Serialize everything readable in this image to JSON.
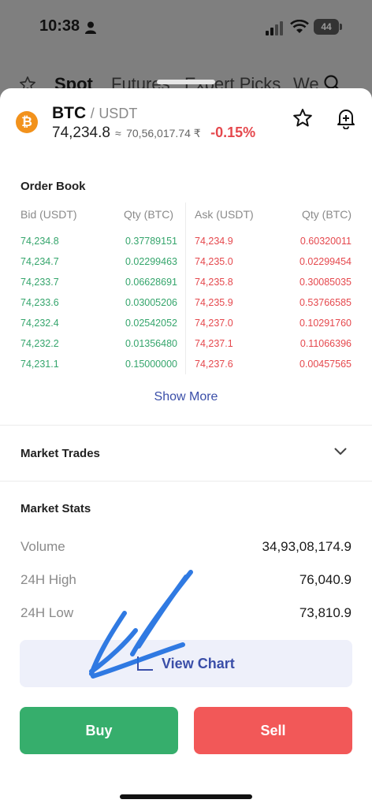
{
  "status_bar": {
    "time": "10:38",
    "battery": "44"
  },
  "background_tabs": [
    "Spot",
    "Futures",
    "Expert Picks",
    "We"
  ],
  "header": {
    "base": "BTC",
    "separator": "/",
    "quote": "USDT",
    "coin_icon": "₿",
    "price": "74,234.8",
    "approx": "≈",
    "price_inr": "70,56,017.74 ₹",
    "change": "-0.15%"
  },
  "order_book": {
    "title": "Order Book",
    "headers": {
      "bid": "Bid (USDT)",
      "bid_qty": "Qty (BTC)",
      "ask": "Ask (USDT)",
      "ask_qty": "Qty (BTC)"
    },
    "rows": [
      {
        "bid": "74,234.8",
        "bid_qty": "0.37789151",
        "ask": "74,234.9",
        "ask_qty": "0.60320011"
      },
      {
        "bid": "74,234.7",
        "bid_qty": "0.02299463",
        "ask": "74,235.0",
        "ask_qty": "0.02299454"
      },
      {
        "bid": "74,233.7",
        "bid_qty": "0.06628691",
        "ask": "74,235.8",
        "ask_qty": "0.30085035"
      },
      {
        "bid": "74,233.6",
        "bid_qty": "0.03005206",
        "ask": "74,235.9",
        "ask_qty": "0.53766585"
      },
      {
        "bid": "74,232.4",
        "bid_qty": "0.02542052",
        "ask": "74,237.0",
        "ask_qty": "0.10291760"
      },
      {
        "bid": "74,232.2",
        "bid_qty": "0.01356480",
        "ask": "74,237.1",
        "ask_qty": "0.11066396"
      },
      {
        "bid": "74,231.1",
        "bid_qty": "0.15000000",
        "ask": "74,237.6",
        "ask_qty": "0.00457565"
      }
    ],
    "show_more": "Show More"
  },
  "market_trades": {
    "title": "Market Trades"
  },
  "market_stats": {
    "title": "Market Stats",
    "items": [
      {
        "label": "Volume",
        "value": "34,93,08,174.9"
      },
      {
        "label": "24H High",
        "value": "76,040.9"
      },
      {
        "label": "24H Low",
        "value": "73,810.9"
      }
    ]
  },
  "actions": {
    "view_chart": "View Chart",
    "buy": "Buy",
    "sell": "Sell"
  },
  "colors": {
    "bid": "#35a56c",
    "ask": "#e5484d",
    "accent": "#3a4ea8",
    "buy": "#36ae6c",
    "sell": "#f25858",
    "coin": "#f2921c"
  }
}
